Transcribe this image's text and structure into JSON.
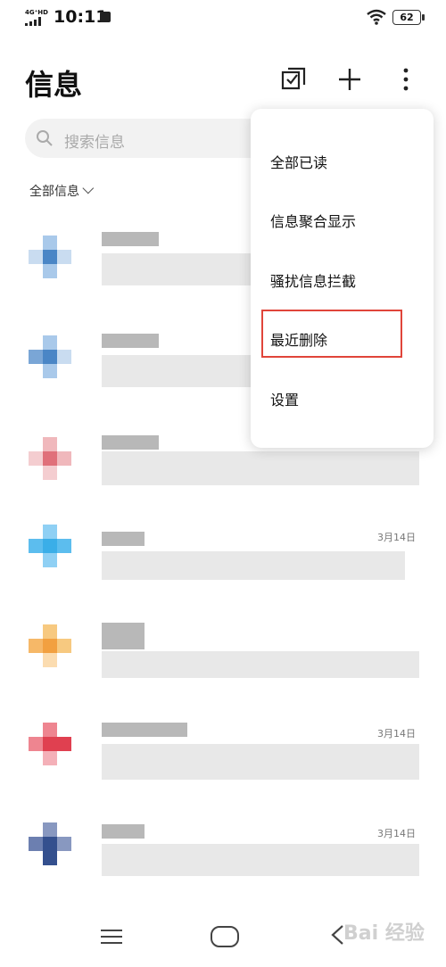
{
  "status_bar": {
    "network": "4G⁺HD",
    "time": "10:11",
    "battery": "62"
  },
  "header": {
    "title": "信息"
  },
  "search": {
    "placeholder": "搜索信息"
  },
  "filter": {
    "label": "全部信息"
  },
  "conversations": [
    {
      "date": ""
    },
    {
      "date": ""
    },
    {
      "date": ""
    },
    {
      "date": "3月14日"
    },
    {
      "date": ""
    },
    {
      "date": "3月14日"
    },
    {
      "date": "3月14日"
    }
  ],
  "menu": {
    "items": [
      "全部已读",
      "信息聚合显示",
      "骚扰信息拦截",
      "最近删除",
      "设置"
    ],
    "highlighted": "最近删除"
  },
  "watermark": "Bai 经验",
  "colors": {
    "highlight_border": "#e0453a",
    "avatars": [
      "#4a86c6",
      "#4a86c6",
      "#e0707a",
      "#3aaee8",
      "#f2a040",
      "#e04050",
      "#34508e"
    ]
  }
}
